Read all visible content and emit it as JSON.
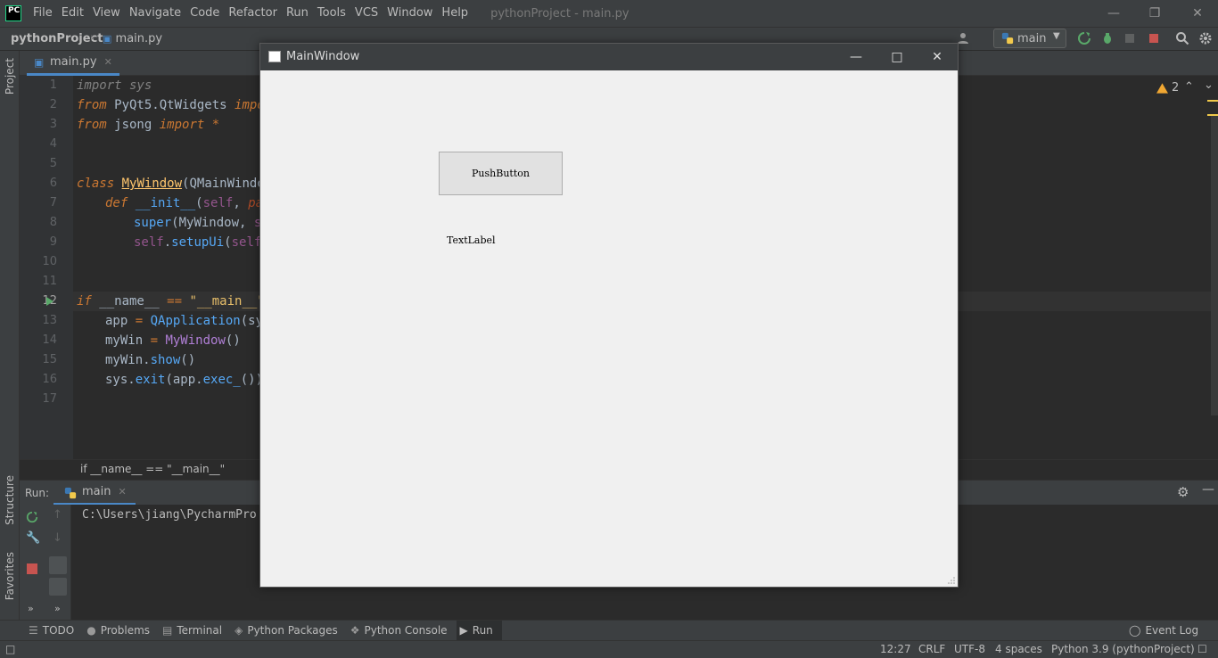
{
  "menubar": {
    "logo": "PC",
    "items": [
      "File",
      "Edit",
      "View",
      "Navigate",
      "Code",
      "Refactor",
      "Run",
      "Tools",
      "VCS",
      "Window",
      "Help"
    ],
    "window_title": "pythonProject - main.py"
  },
  "navbar": {
    "project": "pythonProject",
    "file": "main.py",
    "run_config": "main"
  },
  "left_strip": {
    "project": "Project",
    "structure": "Structure",
    "favorites": "Favorites"
  },
  "editor": {
    "tab": "main.py",
    "warnings": "2",
    "current_line": 12,
    "line_numbers": [
      "1",
      "2",
      "3",
      "4",
      "5",
      "6",
      "7",
      "8",
      "9",
      "10",
      "11",
      "12",
      "13",
      "14",
      "15",
      "16",
      "17"
    ],
    "breadcrumb": "if __name__ == \"__main__\""
  },
  "run_panel": {
    "label": "Run:",
    "tab": "main",
    "console": "C:\\Users\\jiang\\PycharmPro"
  },
  "bottom_tabs": [
    {
      "label": "TODO",
      "icon": "list-icon"
    },
    {
      "label": "Problems",
      "icon": "info-icon"
    },
    {
      "label": "Terminal",
      "icon": "terminal-icon"
    },
    {
      "label": "Python Packages",
      "icon": "layers-icon"
    },
    {
      "label": "Python Console",
      "icon": "python-icon"
    },
    {
      "label": "Run",
      "icon": "run-icon"
    }
  ],
  "event_log": "Event Log",
  "statusbar": {
    "position": "12:27",
    "line_sep": "CRLF",
    "encoding": "UTF-8",
    "indent": "4 spaces",
    "interpreter": "Python 3.9 (pythonProject)"
  },
  "qt_window": {
    "title": "MainWindow",
    "button": "PushButton",
    "label": "TextLabel"
  },
  "colors": {
    "ide_bg": "#2b2b2b",
    "panel_bg": "#3c3f41",
    "keyword": "#cc7832",
    "string": "#6a8759",
    "qt_bg": "#f0f0f0"
  }
}
